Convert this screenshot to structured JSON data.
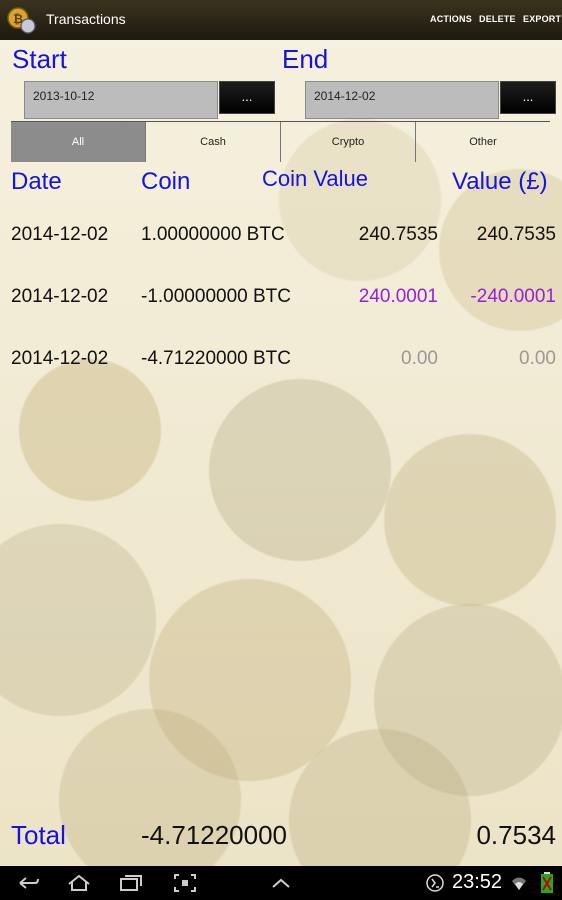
{
  "colors": {
    "accent": "#1414dc",
    "negative": "#9a1fd6",
    "muted": "#999999"
  },
  "actionbar": {
    "title": "Transactions",
    "app_icon": "bitcoin-coin-icon",
    "actions": [
      "ACTIONS",
      "DELETE",
      "EXPORT"
    ]
  },
  "filters": {
    "start_label": "Start",
    "end_label": "End",
    "start_date": "2013-10-12",
    "end_date": "2014-12-02",
    "picker_button": "..."
  },
  "tabs": [
    {
      "label": "All",
      "active": true
    },
    {
      "label": "Cash",
      "active": false
    },
    {
      "label": "Crypto",
      "active": false
    },
    {
      "label": "Other",
      "active": false
    }
  ],
  "table": {
    "headers": [
      "Date",
      "Coin",
      "Coin Value",
      "Value (£)"
    ],
    "rows": [
      {
        "date": "2014-12-02",
        "coin": "1.00000000 BTC",
        "coin_value": "240.7535",
        "value": "240.7535"
      },
      {
        "date": "2014-12-02",
        "coin": "-1.00000000 BTC",
        "coin_value": "240.0001",
        "value": "-240.0001"
      },
      {
        "date": "2014-12-02",
        "coin": "-4.71220000 BTC",
        "coin_value": "0.00",
        "value": "0.00"
      }
    ]
  },
  "totals": {
    "label": "Total",
    "coin": "-4.71220000",
    "value": "0.7534"
  },
  "navbar": {
    "icons": [
      "back-icon",
      "home-icon",
      "recent-apps-icon",
      "screenshot-icon",
      "menu-up-icon"
    ],
    "status_icons": [
      "usb-debug-icon",
      "wifi-icon",
      "battery-icon"
    ],
    "time": "23:52"
  }
}
